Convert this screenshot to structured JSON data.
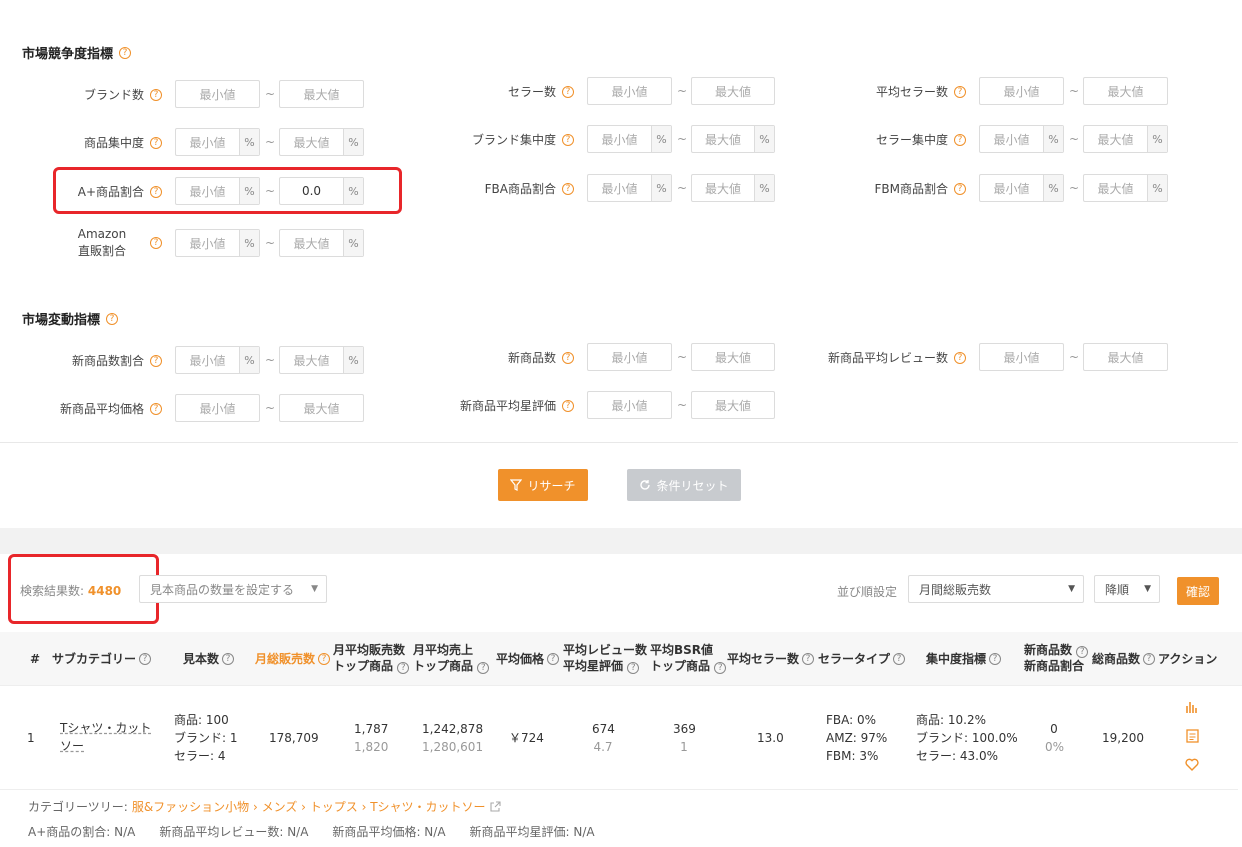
{
  "sec1": {
    "title": "市場競争度指標"
  },
  "sec2": {
    "title": "市場変動指標"
  },
  "min_ph": "最小値",
  "max_ph": "最大値",
  "pct": "%",
  "tilde": "~",
  "fields": {
    "brand_count": "ブランド数",
    "seller_count": "セラー数",
    "avg_seller": "平均セラー数",
    "product_conc": "商品集中度",
    "brand_conc": "ブランド集中度",
    "seller_conc": "セラー集中度",
    "aplus_ratio": "A+商品割合",
    "aplus_max_value": "0.0",
    "fba_ratio": "FBA商品割合",
    "fbm_ratio": "FBM商品割合",
    "amazon_direct_1": "Amazon",
    "amazon_direct_2": "直販割合",
    "new_ratio": "新商品数割合",
    "new_count": "新商品数",
    "new_review": "新商品平均レビュー数",
    "new_price": "新商品平均価格",
    "new_star": "新商品平均星評価"
  },
  "buttons": {
    "research": "リサーチ",
    "reset": "条件リセット",
    "confirm": "確認"
  },
  "results": {
    "label": "検索結果数:",
    "count": "4480",
    "sample_select": "見本商品の数量を設定する",
    "sort_label": "並び順設定",
    "sort_value": "月間総販売数",
    "order_value": "降順"
  },
  "table": {
    "headers": {
      "num": "#",
      "subcat": "サブカテゴリー",
      "sample": "見本数",
      "monthly_sales": "月総販売数",
      "avg_sales_1": "月平均販売数",
      "avg_sales_2": "トップ商品",
      "avg_rev_1": "月平均売上",
      "avg_rev_2": "トップ商品",
      "avg_price": "平均価格",
      "avg_review_1": "平均レビュー数",
      "avg_review_2": "平均星評価",
      "avg_bsr_1": "平均BSR値",
      "avg_bsr_2": "トップ商品",
      "avg_seller": "平均セラー数",
      "seller_type": "セラータイプ",
      "conc": "集中度指標",
      "new_1": "新商品数",
      "new_2": "新商品割合",
      "total": "総商品数",
      "action": "アクション"
    },
    "row": {
      "num": "1",
      "subcat_1": "Tシャツ・カット",
      "subcat_2": "ソー",
      "sample_1": "商品: 100",
      "sample_2": "ブランド: 1",
      "sample_3": "セラー: 4",
      "monthly_sales": "178,709",
      "avg_sales": "1,787",
      "avg_sales_top": "1,820",
      "avg_rev": "1,242,878",
      "avg_rev_top": "1,280,601",
      "avg_price": "￥724",
      "avg_review": "674",
      "avg_star": "4.7",
      "avg_bsr": "369",
      "avg_bsr_top": "1",
      "avg_seller": "13.0",
      "type_1": "FBA: 0%",
      "type_2": "AMZ: 97%",
      "type_3": "FBM: 3%",
      "conc_1": "商品: 10.2%",
      "conc_2": "ブランド: 100.0%",
      "conc_3": "セラー: 43.0%",
      "new_count": "0",
      "new_ratio": "0%",
      "total": "19,200"
    }
  },
  "footer": {
    "tree_label": "カテゴリーツリー:",
    "tree_path": "服&ファッション小物 › メンズ › トップス › Tシャツ・カットソー",
    "stats": "A+商品の割合: N/A　　新商品平均レビュー数: N/A　　新商品平均価格: N/A　　新商品平均星評価: N/A"
  },
  "colors": {
    "accent": "#f0912b",
    "highlight": "#e8262a",
    "disabled": "#c8cbcf"
  }
}
